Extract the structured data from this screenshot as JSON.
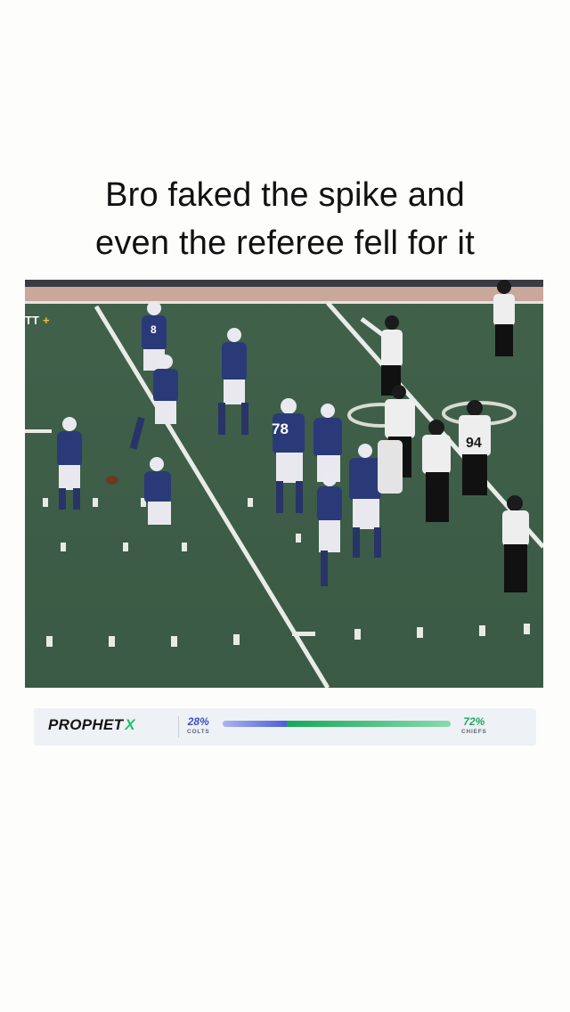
{
  "caption": {
    "line1": "Bro faked the spike and",
    "line2": "even the referee fell for it"
  },
  "video": {
    "description_icon": "football-video-frame",
    "jersey_numbers": [
      "78",
      "94",
      "8"
    ]
  },
  "odds": {
    "brand_main": "PROPHET",
    "brand_accent": "X",
    "left_team": {
      "pct_label": "28%",
      "name": "COLTS",
      "fraction": 0.28,
      "color": "#3b50c8"
    },
    "right_team": {
      "pct_label": "72%",
      "name": "CHIEFS",
      "fraction": 0.72,
      "color": "#22a664"
    }
  },
  "colors": {
    "background": "#fdfdfc",
    "field": "#3d5a46",
    "brand_accent": "#22c06b"
  }
}
